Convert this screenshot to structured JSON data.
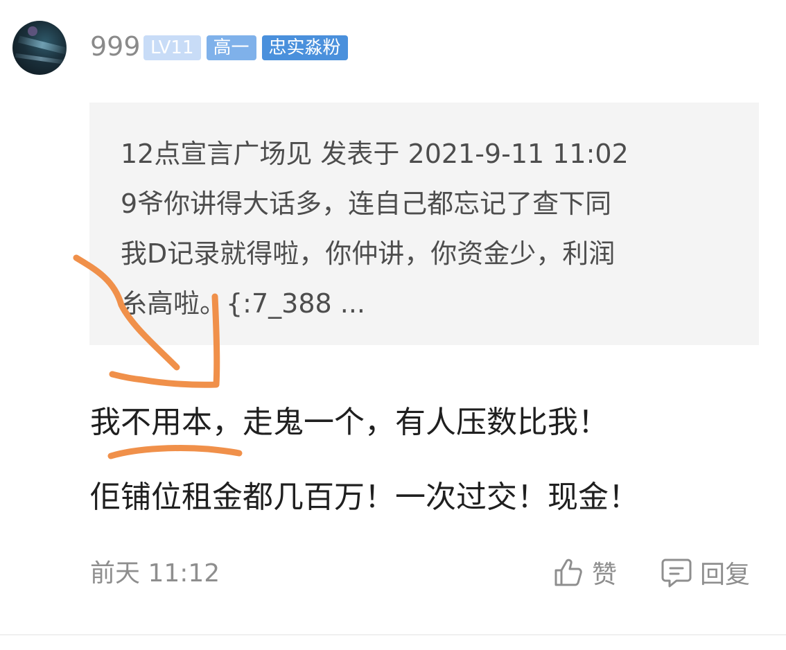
{
  "user": {
    "name": "999",
    "badges": {
      "level": "LV11",
      "grade": "高一",
      "fan": "忠实淼粉"
    }
  },
  "quote": {
    "lines": [
      "12点宣言广场见 发表于 2021-9-11 11:02",
      "9爷你讲得大话多，连自己都忘记了查下同",
      "我D记录就得啦，你仲讲，你资金少，利润",
      "糸高啦。{:7_388 ..."
    ]
  },
  "post": {
    "lines": [
      "我不用本，走鬼一个，有人压数比我！",
      "佢铺位租金都几百万！一次过交！现金！"
    ]
  },
  "footer": {
    "time": "前天 11:12",
    "like_label": "赞",
    "reply_label": "回复"
  },
  "colors": {
    "annotation": "#f0904a",
    "badge_level": "#c8dcf7",
    "badge_grade": "#7fb1ea",
    "badge_fan": "#4a90dc",
    "quote_background": "#f4f4f4"
  },
  "icons": {
    "like": "thumbs-up-icon",
    "reply": "comment-icon"
  }
}
